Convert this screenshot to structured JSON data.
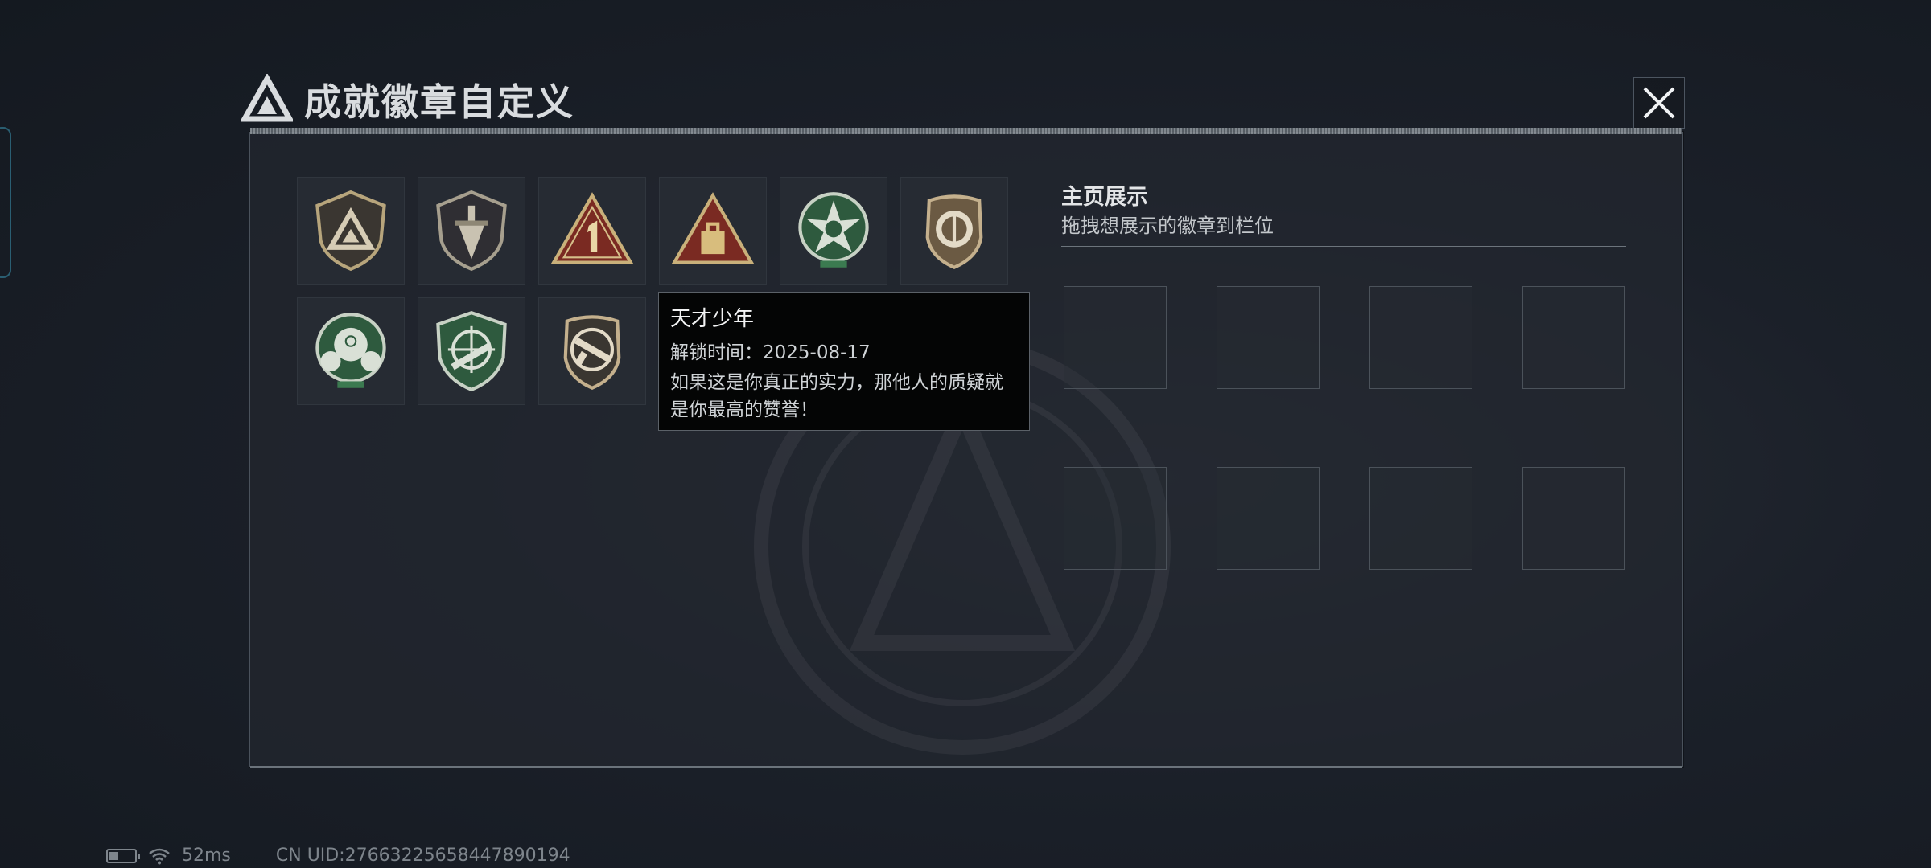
{
  "header": {
    "title": "成就徽章自定义",
    "logo_icon": "triangle-logo-icon",
    "close_icon": "close-icon"
  },
  "badges": [
    {
      "icon": "triangle-shield-badge-icon",
      "color": "#9c8f6e"
    },
    {
      "icon": "dagger-shield-badge-icon",
      "color": "#8e8775"
    },
    {
      "icon": "number-one-triangle-badge-icon",
      "color": "#8b2a22"
    },
    {
      "icon": "box-triangle-badge-icon",
      "color": "#8b2a22"
    },
    {
      "icon": "skull-star-badge-icon",
      "color": "#2e5a3e"
    },
    {
      "icon": "emblem-shield-badge-icon",
      "color": "#8a7455"
    },
    {
      "icon": "crosshair-skull-badge-icon",
      "color": "#2e5a3e"
    },
    {
      "icon": "rifle-crosshair-badge-icon",
      "color": "#2e5a3e"
    },
    {
      "icon": "rifle-shield-badge-icon",
      "color": "#8a7455"
    },
    {
      "icon": "locked-green-badge-icon",
      "color": "#2e5a3e"
    }
  ],
  "tooltip": {
    "name": "天才少年",
    "unlock": "解锁时间：2025-08-17",
    "description": "如果这是你真正的实力，那他人的质疑就是你最高的赞誉！"
  },
  "showcase": {
    "title": "主页展示",
    "subtitle": "拖拽想展示的徽章到栏位",
    "slot_count": 8
  },
  "status_bar": {
    "ping": "52ms",
    "uid": "CN UID:27663225658447890194",
    "battery_level": 0.35
  }
}
